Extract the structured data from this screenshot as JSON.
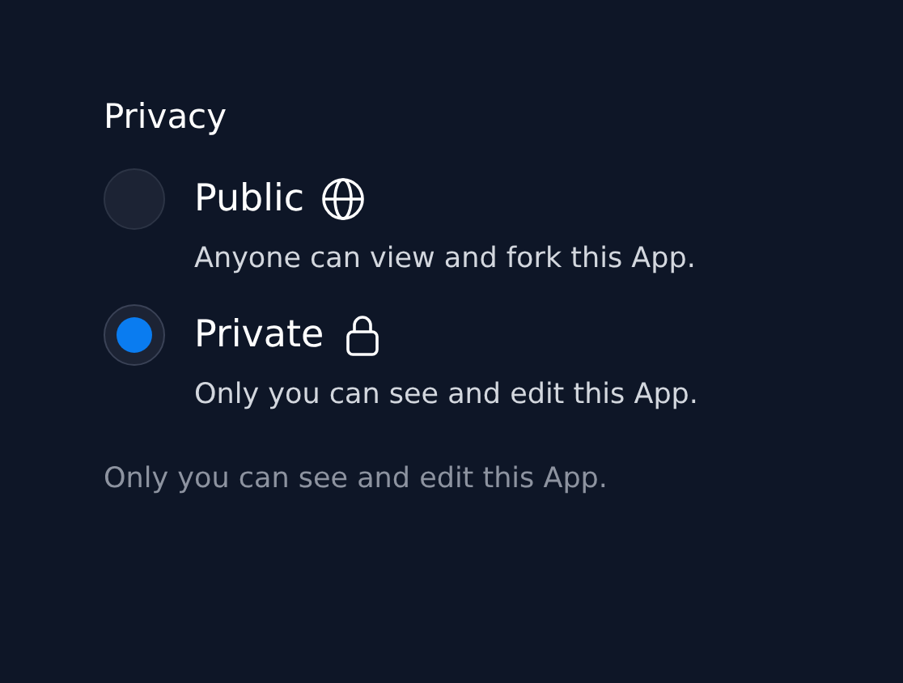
{
  "title": "Privacy",
  "options": [
    {
      "label": "Public",
      "kind": "public",
      "description": "Anyone can view and fork this App.",
      "selected": false
    },
    {
      "label": "Private",
      "kind": "private",
      "description": "Only you can see and edit this App.",
      "selected": true
    }
  ],
  "note": "Only you can see and edit this App."
}
